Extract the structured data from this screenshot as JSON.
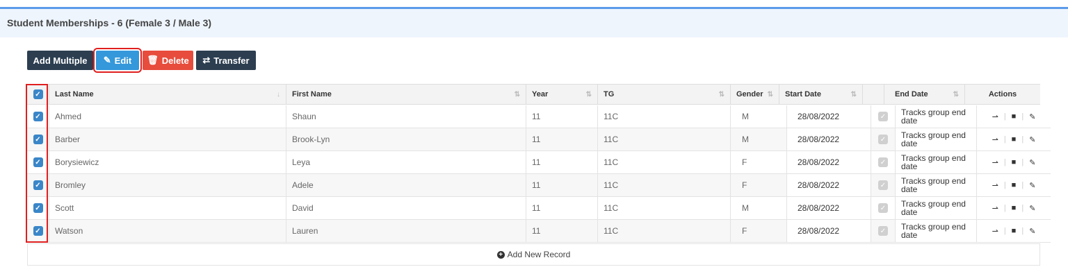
{
  "header": {
    "title": "Student Memberships - 6 (Female 3 / Male 3)"
  },
  "toolbar": {
    "add_multiple": "Add Multiple",
    "edit": "Edit",
    "delete": "Delete",
    "transfer": "Transfer"
  },
  "table": {
    "columns": [
      "Last Name",
      "First Name",
      "Year",
      "TG",
      "Gender",
      "Start Date",
      "End Date",
      "Actions"
    ],
    "rows": [
      {
        "last": "Ahmed",
        "first": "Shaun",
        "year": "11",
        "tg": "11C",
        "gender": "M",
        "start": "28/08/2022",
        "end": "Tracks group end date"
      },
      {
        "last": "Barber",
        "first": "Brook-Lyn",
        "year": "11",
        "tg": "11C",
        "gender": "M",
        "start": "28/08/2022",
        "end": "Tracks group end date"
      },
      {
        "last": "Borysiewicz",
        "first": "Leya",
        "year": "11",
        "tg": "11C",
        "gender": "F",
        "start": "28/08/2022",
        "end": "Tracks group end date"
      },
      {
        "last": "Bromley",
        "first": "Adele",
        "year": "11",
        "tg": "11C",
        "gender": "F",
        "start": "28/08/2022",
        "end": "Tracks group end date"
      },
      {
        "last": "Scott",
        "first": "David",
        "year": "11",
        "tg": "11C",
        "gender": "M",
        "start": "28/08/2022",
        "end": "Tracks group end date"
      },
      {
        "last": "Watson",
        "first": "Lauren",
        "year": "11",
        "tg": "11C",
        "gender": "F",
        "start": "28/08/2022",
        "end": "Tracks group end date"
      }
    ]
  },
  "footer": {
    "add_record": "Add New Record"
  }
}
